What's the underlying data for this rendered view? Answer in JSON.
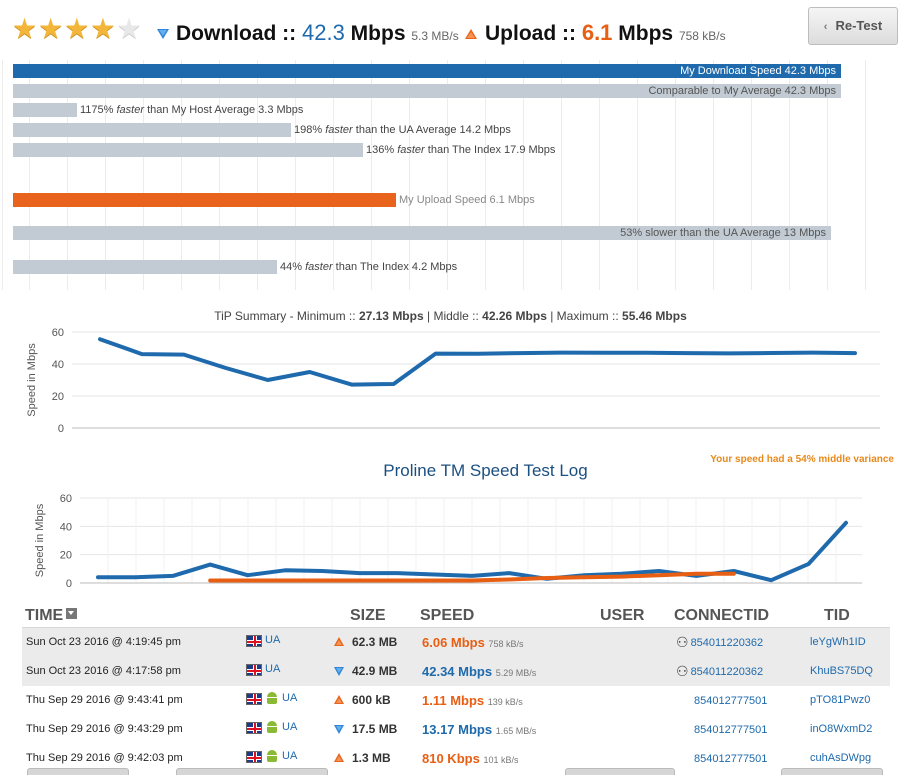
{
  "rating": {
    "filled": 4,
    "total": 5
  },
  "header": {
    "download_label": "Download ::",
    "download_value": "42.3",
    "download_unit": "Mbps",
    "download_bytes": "5.3 MB/s",
    "upload_label": "Upload ::",
    "upload_value": "6.1",
    "upload_unit": "Mbps",
    "upload_bytes": "758 kB/s",
    "retest_label": "Re-Test"
  },
  "download_bars": [
    {
      "key": "my",
      "text": "My Download Speed 42.3 Mbps",
      "value": 42.3,
      "pct": 1.0,
      "color": "#1e6aad",
      "label_inside": true,
      "text_white": true
    },
    {
      "key": "avg",
      "text": "Comparable to My Average 42.3 Mbps",
      "value": 42.3,
      "pct": 1.0,
      "color": "#c2cbd3",
      "label_inside": true,
      "text_white": false
    },
    {
      "key": "host",
      "pre": "1175%",
      "em": "faster",
      "post": "than My Host Average 3.3 Mbps",
      "value": 3.3,
      "color": "#c2cbd3"
    },
    {
      "key": "ua",
      "pre": "198%",
      "em": "faster",
      "post": "than the UA Average 14.2 Mbps",
      "value": 14.2,
      "color": "#c2cbd3"
    },
    {
      "key": "index",
      "pre": "136%",
      "em": "faster",
      "post": "than The Index 17.9 Mbps",
      "value": 17.9,
      "color": "#c2cbd3"
    }
  ],
  "upload_bars": [
    {
      "key": "my",
      "text": "My Upload Speed 6.1 Mbps",
      "value": 6.1,
      "color": "#e8641c"
    },
    {
      "key": "ua",
      "text": "53% slower than the UA Average 13 Mbps",
      "value": 13,
      "color": "#c2cbd3"
    },
    {
      "key": "index",
      "pre": "44%",
      "em": "faster",
      "post": "than The Index 4.2 Mbps",
      "value": 4.2,
      "color": "#c2cbd3"
    }
  ],
  "tip_summary": {
    "prefix": "TiP Summary - Minimum ::",
    "min": "27.13",
    "mid_label": "Middle ::",
    "mid": "42.26",
    "max_label": "Maximum ::",
    "max": "55.46",
    "unit": "Mbps"
  },
  "variance_note": "Your speed had a 54% middle variance",
  "log_title": "Proline TM Speed Test Log",
  "chart_data": [
    {
      "type": "line",
      "title": "TiP Summary - Minimum :: 27.13 Mbps | Middle :: 42.26 Mbps | Maximum :: 55.46 Mbps",
      "ylabel": "Speed in Mbps",
      "ylim": [
        0,
        60
      ],
      "yticks": [
        0,
        20,
        40,
        60
      ],
      "series": [
        {
          "color": "#1e6aad",
          "values": [
            55.5,
            46.2,
            45.9,
            37.5,
            30.0,
            35.0,
            27.1,
            27.5,
            46.5,
            46.4,
            46.8,
            47.1,
            47.0,
            47.0,
            46.8,
            46.6,
            46.9,
            47.1,
            46.8
          ]
        }
      ]
    },
    {
      "type": "line",
      "title": "Proline TM Speed Test Log",
      "ylabel": "Speed in Mbps",
      "ylim": [
        0,
        60
      ],
      "yticks": [
        0,
        20,
        40,
        60
      ],
      "series": [
        {
          "color": "#1e6aad",
          "values": [
            4,
            4,
            5,
            13,
            5.5,
            9,
            8.5,
            7,
            7,
            6,
            5,
            7,
            3,
            5.5,
            6.5,
            8.5,
            5,
            8.5,
            2,
            13.5,
            42.5
          ]
        },
        {
          "color": "#e85e12",
          "values": [
            null,
            null,
            null,
            1.8,
            1.8,
            1.8,
            1.8,
            1.8,
            1.8,
            1.8,
            1.8,
            2.5,
            3.5,
            4,
            4.5,
            5.5,
            6.5,
            6.5,
            null,
            null,
            null
          ]
        }
      ]
    }
  ],
  "table": {
    "headers": {
      "time": "TIME",
      "size": "SIZE",
      "speed": "SPEED",
      "user": "USER",
      "connectid": "CONNECTID",
      "tid": "TID"
    },
    "rows": [
      {
        "time": "Sun Oct 23 2016 @ 4:19:45 pm",
        "country": "UA",
        "android": false,
        "dir": "up",
        "size": "62.3 MB",
        "speed": "6.06 Mbps",
        "bytes": "758 kB/s",
        "connectid": "854011220362",
        "user_icon": true,
        "tid": "leYgWh1ID"
      },
      {
        "time": "Sun Oct 23 2016 @ 4:17:58 pm",
        "country": "UA",
        "android": false,
        "dir": "down",
        "size": "42.9 MB",
        "speed": "42.34 Mbps",
        "bytes": "5.29 MB/s",
        "connectid": "854011220362",
        "user_icon": true,
        "tid": "KhuBS75DQ"
      },
      {
        "time": "Thu Sep 29 2016 @ 9:43:41 pm",
        "country": "UA",
        "android": true,
        "dir": "up",
        "size": "600 kB",
        "speed": "1.11 Mbps",
        "bytes": "139 kB/s",
        "connectid": "854012777501",
        "user_icon": false,
        "tid": "pTO81Pwz0"
      },
      {
        "time": "Thu Sep 29 2016 @ 9:43:29 pm",
        "country": "UA",
        "android": true,
        "dir": "down",
        "size": "17.5 MB",
        "speed": "13.17 Mbps",
        "bytes": "1.65 MB/s",
        "connectid": "854012777501",
        "user_icon": false,
        "tid": "inO8WxmD2"
      },
      {
        "time": "Thu Sep 29 2016 @ 9:42:03 pm",
        "country": "UA",
        "android": true,
        "dir": "up",
        "size": "1.3 MB",
        "speed": "810 Kbps",
        "bytes": "101 kB/s",
        "connectid": "854012777501",
        "user_icon": false,
        "tid": "cuhAsDWpg"
      }
    ]
  }
}
